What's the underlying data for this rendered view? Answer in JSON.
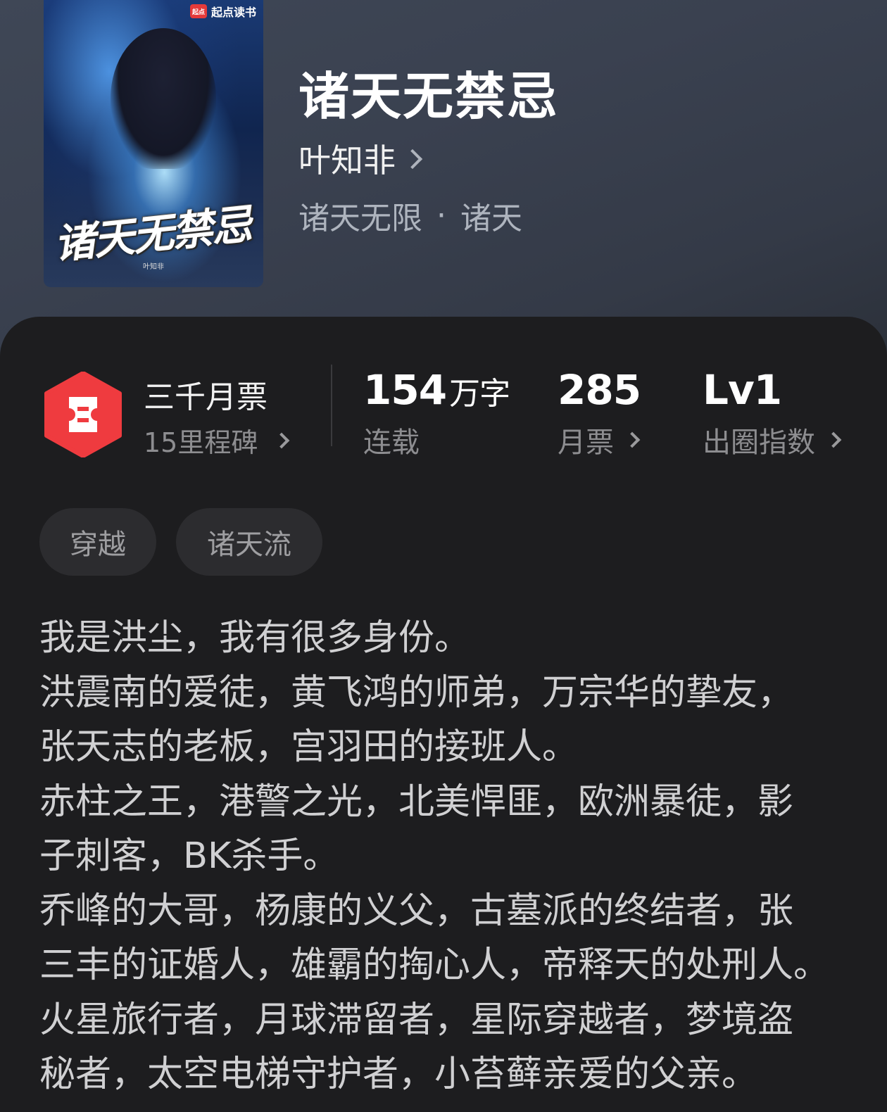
{
  "cover": {
    "logo_text": "起点读书",
    "logo_badge": "起点",
    "title_art": "诸天无禁忌",
    "author_small": "叶知非"
  },
  "book": {
    "title": "诸天无禁忌",
    "author": "叶知非",
    "category": "诸天无限",
    "separator": "·",
    "subcategory": "诸天"
  },
  "stats": {
    "ticket": {
      "title": "三千月票",
      "sub": "15里程碑"
    },
    "words": {
      "value": "154",
      "unit": "万字",
      "label": "连载"
    },
    "monthly": {
      "value": "285",
      "label": "月票"
    },
    "level": {
      "value": "Lv1",
      "label": "出圈指数"
    }
  },
  "tags": [
    "穿越",
    "诸天流"
  ],
  "description_lines": [
    "我是洪尘，我有很多身份。",
    "洪震南的爱徒，黄飞鸿的师弟，万宗华的挚友，",
    "张天志的老板，宫羽田的接班人。",
    "赤柱之王，港警之光，北美悍匪，欧洲暴徒，影",
    "子刺客，BK杀手。",
    "乔峰的大哥，杨康的义父，古墓派的终结者，张",
    "三丰的证婚人，雄霸的掏心人，帝释天的处刑人。",
    "火星旅行者，月球滞留者，星际穿越者，梦境盗",
    "秘者，太空电梯守护者，小苔藓亲爱的父亲。"
  ],
  "colors": {
    "hero_bg": "#3d4453",
    "panel_bg": "#1d1d1f",
    "ticket_red": "#ef3b3f",
    "tag_bg": "#2c2c2f"
  }
}
